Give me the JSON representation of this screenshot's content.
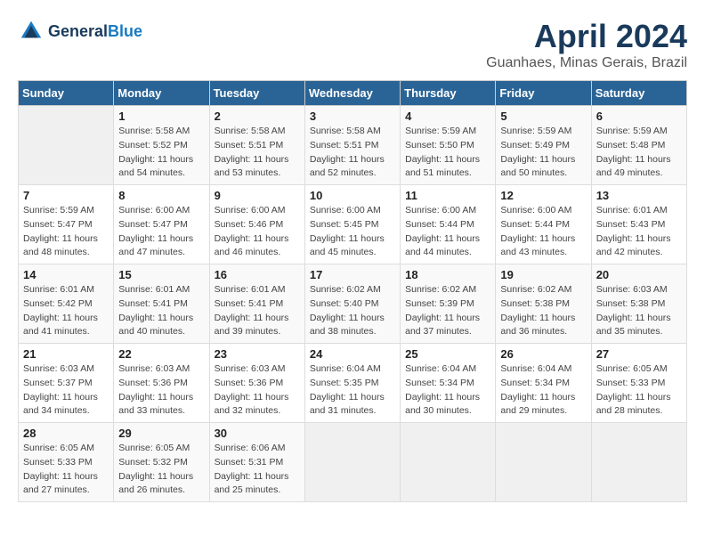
{
  "header": {
    "logo_general": "General",
    "logo_blue": "Blue",
    "title": "April 2024",
    "subtitle": "Guanhaes, Minas Gerais, Brazil"
  },
  "days_of_week": [
    "Sunday",
    "Monday",
    "Tuesday",
    "Wednesday",
    "Thursday",
    "Friday",
    "Saturday"
  ],
  "weeks": [
    [
      {
        "day": "",
        "info": ""
      },
      {
        "day": "1",
        "info": "Sunrise: 5:58 AM\nSunset: 5:52 PM\nDaylight: 11 hours\nand 54 minutes."
      },
      {
        "day": "2",
        "info": "Sunrise: 5:58 AM\nSunset: 5:51 PM\nDaylight: 11 hours\nand 53 minutes."
      },
      {
        "day": "3",
        "info": "Sunrise: 5:58 AM\nSunset: 5:51 PM\nDaylight: 11 hours\nand 52 minutes."
      },
      {
        "day": "4",
        "info": "Sunrise: 5:59 AM\nSunset: 5:50 PM\nDaylight: 11 hours\nand 51 minutes."
      },
      {
        "day": "5",
        "info": "Sunrise: 5:59 AM\nSunset: 5:49 PM\nDaylight: 11 hours\nand 50 minutes."
      },
      {
        "day": "6",
        "info": "Sunrise: 5:59 AM\nSunset: 5:48 PM\nDaylight: 11 hours\nand 49 minutes."
      }
    ],
    [
      {
        "day": "7",
        "info": "Sunrise: 5:59 AM\nSunset: 5:47 PM\nDaylight: 11 hours\nand 48 minutes."
      },
      {
        "day": "8",
        "info": "Sunrise: 6:00 AM\nSunset: 5:47 PM\nDaylight: 11 hours\nand 47 minutes."
      },
      {
        "day": "9",
        "info": "Sunrise: 6:00 AM\nSunset: 5:46 PM\nDaylight: 11 hours\nand 46 minutes."
      },
      {
        "day": "10",
        "info": "Sunrise: 6:00 AM\nSunset: 5:45 PM\nDaylight: 11 hours\nand 45 minutes."
      },
      {
        "day": "11",
        "info": "Sunrise: 6:00 AM\nSunset: 5:44 PM\nDaylight: 11 hours\nand 44 minutes."
      },
      {
        "day": "12",
        "info": "Sunrise: 6:00 AM\nSunset: 5:44 PM\nDaylight: 11 hours\nand 43 minutes."
      },
      {
        "day": "13",
        "info": "Sunrise: 6:01 AM\nSunset: 5:43 PM\nDaylight: 11 hours\nand 42 minutes."
      }
    ],
    [
      {
        "day": "14",
        "info": "Sunrise: 6:01 AM\nSunset: 5:42 PM\nDaylight: 11 hours\nand 41 minutes."
      },
      {
        "day": "15",
        "info": "Sunrise: 6:01 AM\nSunset: 5:41 PM\nDaylight: 11 hours\nand 40 minutes."
      },
      {
        "day": "16",
        "info": "Sunrise: 6:01 AM\nSunset: 5:41 PM\nDaylight: 11 hours\nand 39 minutes."
      },
      {
        "day": "17",
        "info": "Sunrise: 6:02 AM\nSunset: 5:40 PM\nDaylight: 11 hours\nand 38 minutes."
      },
      {
        "day": "18",
        "info": "Sunrise: 6:02 AM\nSunset: 5:39 PM\nDaylight: 11 hours\nand 37 minutes."
      },
      {
        "day": "19",
        "info": "Sunrise: 6:02 AM\nSunset: 5:38 PM\nDaylight: 11 hours\nand 36 minutes."
      },
      {
        "day": "20",
        "info": "Sunrise: 6:03 AM\nSunset: 5:38 PM\nDaylight: 11 hours\nand 35 minutes."
      }
    ],
    [
      {
        "day": "21",
        "info": "Sunrise: 6:03 AM\nSunset: 5:37 PM\nDaylight: 11 hours\nand 34 minutes."
      },
      {
        "day": "22",
        "info": "Sunrise: 6:03 AM\nSunset: 5:36 PM\nDaylight: 11 hours\nand 33 minutes."
      },
      {
        "day": "23",
        "info": "Sunrise: 6:03 AM\nSunset: 5:36 PM\nDaylight: 11 hours\nand 32 minutes."
      },
      {
        "day": "24",
        "info": "Sunrise: 6:04 AM\nSunset: 5:35 PM\nDaylight: 11 hours\nand 31 minutes."
      },
      {
        "day": "25",
        "info": "Sunrise: 6:04 AM\nSunset: 5:34 PM\nDaylight: 11 hours\nand 30 minutes."
      },
      {
        "day": "26",
        "info": "Sunrise: 6:04 AM\nSunset: 5:34 PM\nDaylight: 11 hours\nand 29 minutes."
      },
      {
        "day": "27",
        "info": "Sunrise: 6:05 AM\nSunset: 5:33 PM\nDaylight: 11 hours\nand 28 minutes."
      }
    ],
    [
      {
        "day": "28",
        "info": "Sunrise: 6:05 AM\nSunset: 5:33 PM\nDaylight: 11 hours\nand 27 minutes."
      },
      {
        "day": "29",
        "info": "Sunrise: 6:05 AM\nSunset: 5:32 PM\nDaylight: 11 hours\nand 26 minutes."
      },
      {
        "day": "30",
        "info": "Sunrise: 6:06 AM\nSunset: 5:31 PM\nDaylight: 11 hours\nand 25 minutes."
      },
      {
        "day": "",
        "info": ""
      },
      {
        "day": "",
        "info": ""
      },
      {
        "day": "",
        "info": ""
      },
      {
        "day": "",
        "info": ""
      }
    ]
  ]
}
